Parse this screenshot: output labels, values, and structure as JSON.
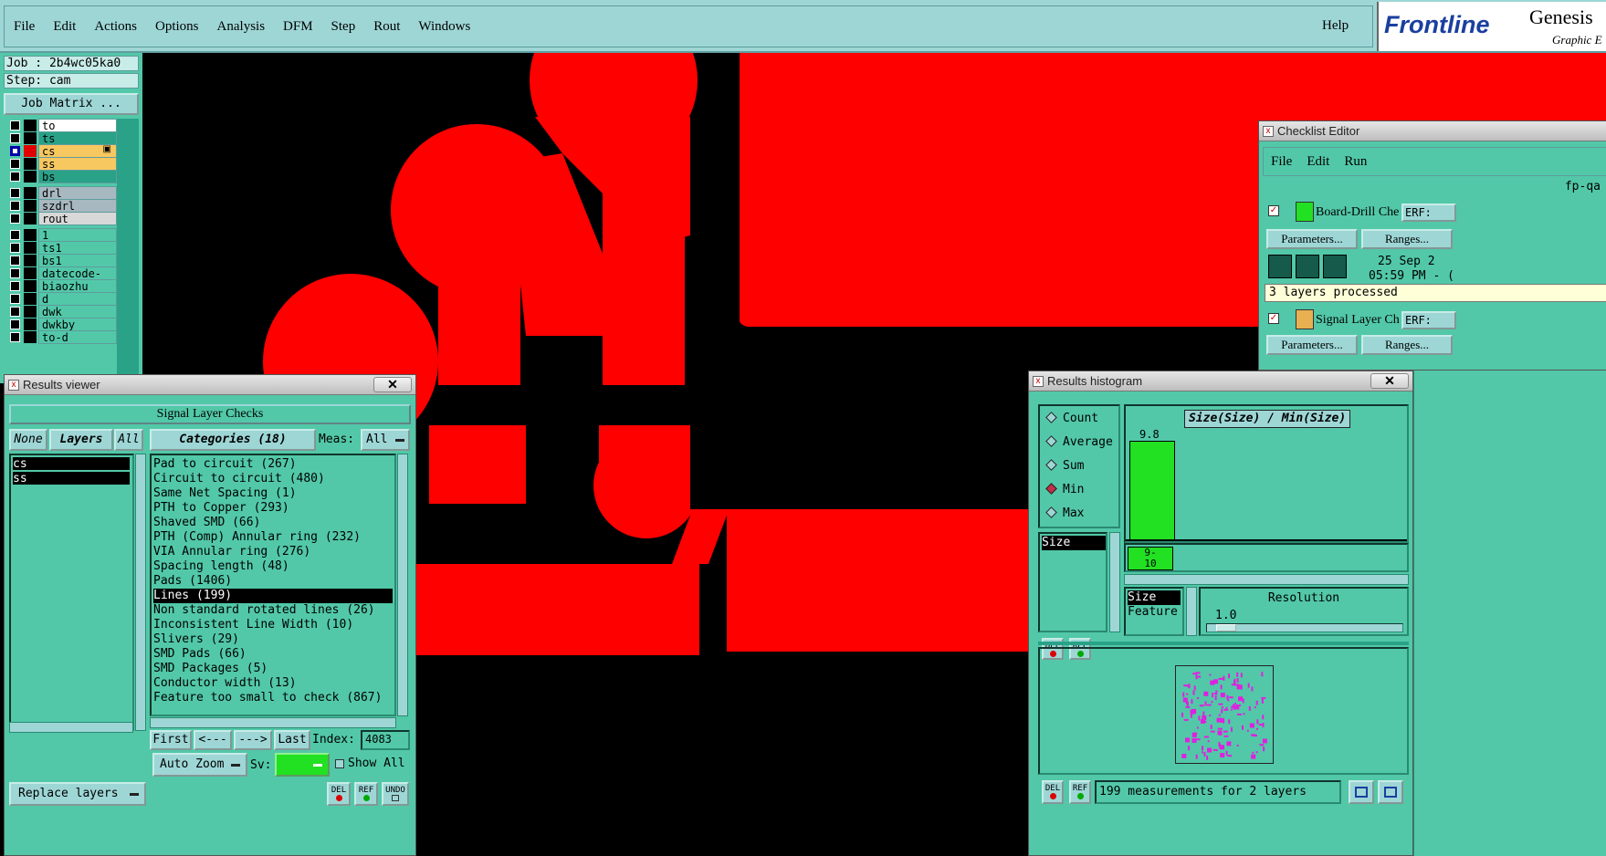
{
  "menus": [
    "File",
    "Edit",
    "Actions",
    "Options",
    "Analysis",
    "DFM",
    "Step",
    "Rout",
    "Windows"
  ],
  "help": "Help",
  "brand": {
    "logo": "Frontline",
    "title": "Genesis",
    "subtitle": "Graphic E"
  },
  "job": {
    "job": "Job : 2b4wc05ka0",
    "step": "Step: cam",
    "matrix": "Job Matrix ..."
  },
  "layers": [
    {
      "name": "to",
      "bg": "#ffffff",
      "swatch": "#000000",
      "sel": false
    },
    {
      "name": "ts",
      "bg": "#2aa288",
      "swatch": "#000000",
      "sel": false
    },
    {
      "name": "cs",
      "bg": "#f8c860",
      "swatch": "#e00000",
      "sel": true,
      "mark": "▣"
    },
    {
      "name": "ss",
      "bg": "#f8c860",
      "swatch": "#000000",
      "sel": false
    },
    {
      "name": "bs",
      "bg": "#2aa288",
      "swatch": "#000000",
      "sel": false
    },
    {
      "name": "drl",
      "bg": "#a8b8c0",
      "swatch": "#000000",
      "sel": false
    },
    {
      "name": "szdrl",
      "bg": "#a8b8c0",
      "swatch": "#000000",
      "sel": false
    },
    {
      "name": "rout",
      "bg": "#d8d8d8",
      "swatch": "#000000",
      "sel": false
    },
    {
      "name": "1",
      "bg": "#52c8a8",
      "swatch": "#000000",
      "sel": false
    },
    {
      "name": "ts1",
      "bg": "#52c8a8",
      "swatch": "#000000",
      "sel": false
    },
    {
      "name": "bs1",
      "bg": "#52c8a8",
      "swatch": "#000000",
      "sel": false
    },
    {
      "name": "datecode-ptc",
      "bg": "#52c8a8",
      "swatch": "#000000",
      "sel": false
    },
    {
      "name": "biaozhu",
      "bg": "#52c8a8",
      "swatch": "#000000",
      "sel": false
    },
    {
      "name": "d",
      "bg": "#52c8a8",
      "swatch": "#000000",
      "sel": false
    },
    {
      "name": "dwk",
      "bg": "#52c8a8",
      "swatch": "#000000",
      "sel": false
    },
    {
      "name": "dwkby",
      "bg": "#52c8a8",
      "swatch": "#000000",
      "sel": false
    },
    {
      "name": "to-d",
      "bg": "#52c8a8",
      "swatch": "#000000",
      "sel": false
    }
  ],
  "results_viewer": {
    "title": "Results viewer",
    "header": "Signal Layer Checks",
    "none": "None",
    "layers": "Layers",
    "all": "All",
    "categories_label": "Categories (18)",
    "meas_label": "Meas:",
    "meas_value": "All",
    "layer_items": [
      "cs",
      "ss"
    ],
    "categories": [
      "Pad to circuit (267)",
      "Circuit to circuit (480)",
      "Same Net Spacing (1)",
      "PTH to Copper (293)",
      "Shaved SMD (66)",
      "PTH (Comp) Annular ring (232)",
      "VIA Annular ring (276)",
      "Spacing length (48)",
      "Pads (1406)",
      "Lines (199)",
      "Non standard rotated lines (26)",
      "Inconsistent Line Width (10)",
      "Slivers (29)",
      "SMD Pads (66)",
      "SMD Packages (5)",
      "Conductor width (13)",
      "Feature too small to check (867)"
    ],
    "selected_category": "Lines (199)",
    "first": "First",
    "prev": "<---",
    "next": "--->",
    "last": "Last",
    "index_label": "Index:",
    "index_value": "4083",
    "autozoom": "Auto Zoom",
    "sv_label": "Sv:",
    "show_all": "Show All",
    "replace": "Replace layers",
    "del": "DEL",
    "ref": "REF",
    "undo": "UNDO"
  },
  "histogram": {
    "title": "Results histogram",
    "modes": [
      "Count",
      "Average",
      "Sum",
      "Min",
      "Max"
    ],
    "selected_mode": "Min",
    "size_item": "Size",
    "chart_title": "Size(Size) / Min(Size)",
    "bar_value": "9.8",
    "bar_label": "9-\n10",
    "props": [
      "Size",
      "Feature"
    ],
    "resolution_label": "Resolution",
    "resolution_value": "1.0",
    "status": "199 measurements for 2 layers",
    "del": "DEL",
    "ref": "REF"
  },
  "checklist": {
    "title": "Checklist Editor",
    "menus": [
      "File",
      "Edit",
      "Run"
    ],
    "name": "fp-qa",
    "check1": "Board-Drill Che",
    "erf": "ERF:",
    "params": "Parameters...",
    "ranges": "Ranges...",
    "date": "25 Sep 2",
    "time": "05:59 PM - (",
    "processed": "3 layers processed",
    "check2": "Signal Layer Ch"
  },
  "colors": {
    "panel": "#52c8a8",
    "light": "#9ed6d6",
    "copper": "#ff0000",
    "bar": "#22e022"
  }
}
